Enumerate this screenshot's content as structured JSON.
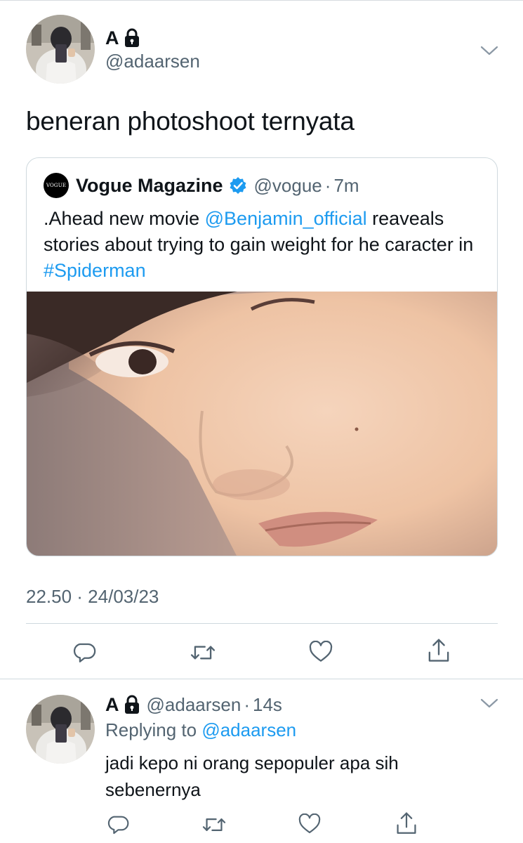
{
  "tweet": {
    "author_name": "A",
    "author_handle": "@adaarsen",
    "text": "beneran photoshoot ternyata",
    "timestamp": "22.50 · 24/03/23"
  },
  "quote": {
    "logo_text": "VOGUE",
    "name": "Vogue Magazine",
    "handle": "@vogue",
    "dot": "·",
    "time": "7m",
    "text_prefix": ".Ahead new movie ",
    "mention": "@Benjamin_official",
    "text_middle": " reaveals stories about trying to gain weight for he caracter in ",
    "hashtag": "#Spiderman"
  },
  "reply": {
    "author_name": "A",
    "author_handle": "@adaarsen",
    "dot": "·",
    "time": "14s",
    "replying_label": "Replying to ",
    "replying_to": "@adaarsen",
    "text": "jadi kepo ni orang sepopuler apa sih sebenernya"
  },
  "icons": {
    "lock": "lock-icon",
    "verified": "verified-badge-icon",
    "more": "chevron-down-icon",
    "reply": "reply-icon",
    "retweet": "retweet-icon",
    "like": "heart-icon",
    "share": "share-icon"
  },
  "colors": {
    "text": "#0f1419",
    "secondary": "#536471",
    "link": "#1d9bf0",
    "border": "#cfd9de"
  }
}
